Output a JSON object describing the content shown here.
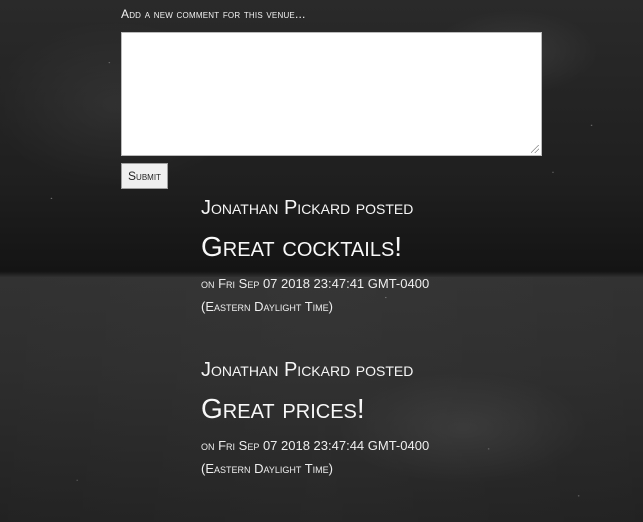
{
  "form": {
    "label": "Add a new comment for this venue...",
    "textarea_value": "",
    "submit_label": "Submit"
  },
  "comments": [
    {
      "author": "Jonathan Pickard",
      "verb": "posted",
      "title": "Great cocktails!",
      "timestamp": "on Fri Sep 07 2018 23:47:41 GMT-0400 (Eastern Daylight Time)"
    },
    {
      "author": "Jonathan Pickard",
      "verb": "posted",
      "title": "Great prices!",
      "timestamp": "on Fri Sep 07 2018 23:47:44 GMT-0400 (Eastern Daylight Time)"
    }
  ],
  "colors": {
    "background": "#1f1f1f",
    "text": "#f4f4f4",
    "button": "#f0f0f0"
  }
}
